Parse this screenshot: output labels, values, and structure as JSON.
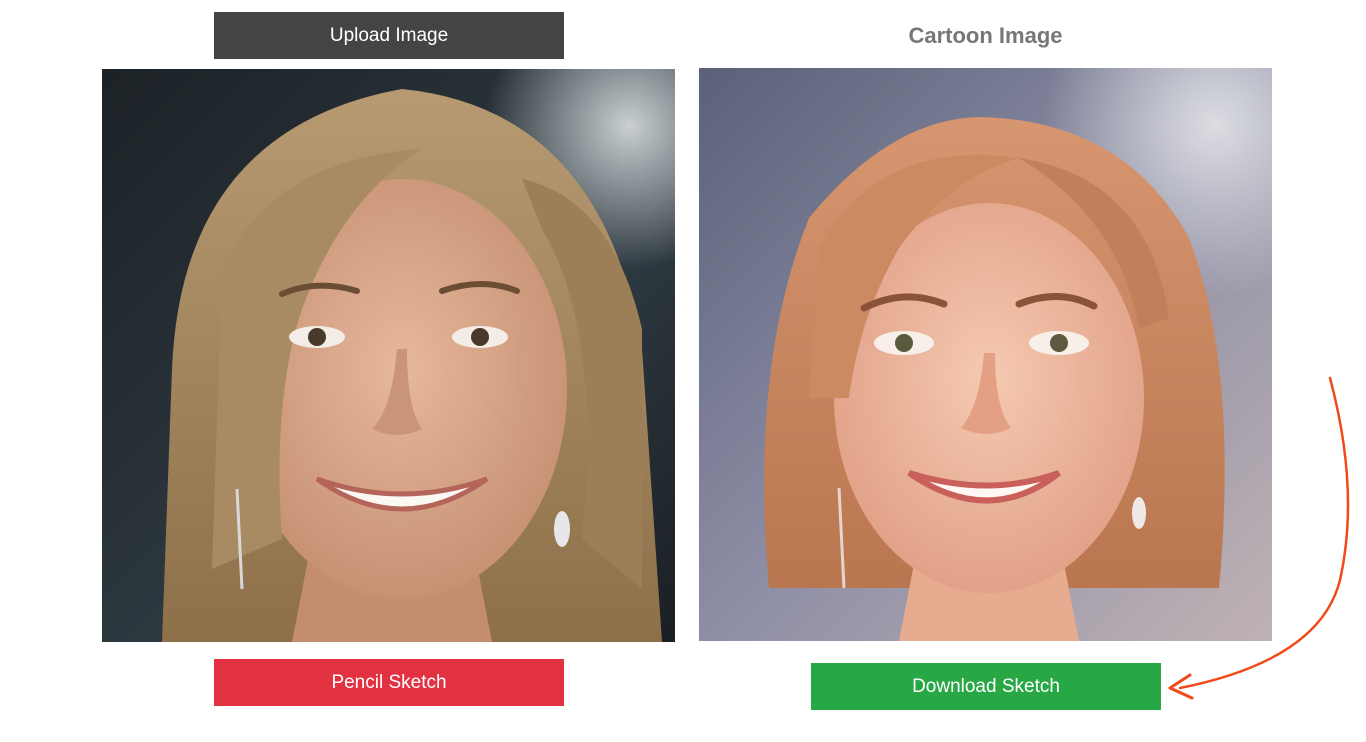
{
  "upload_button": {
    "label": "Upload Image"
  },
  "original_image": {
    "alt": "Uploaded portrait photo"
  },
  "pencil_button": {
    "label": "Pencil Sketch"
  },
  "cartoon": {
    "title": "Cartoon Image",
    "alt": "Cartoon version of portrait"
  },
  "download_button": {
    "label": "Download Sketch"
  },
  "colors": {
    "upload": "#444444",
    "pencil": "#e23241",
    "download": "#28a745",
    "title": "#777777",
    "arrow": "#f04a1a"
  }
}
